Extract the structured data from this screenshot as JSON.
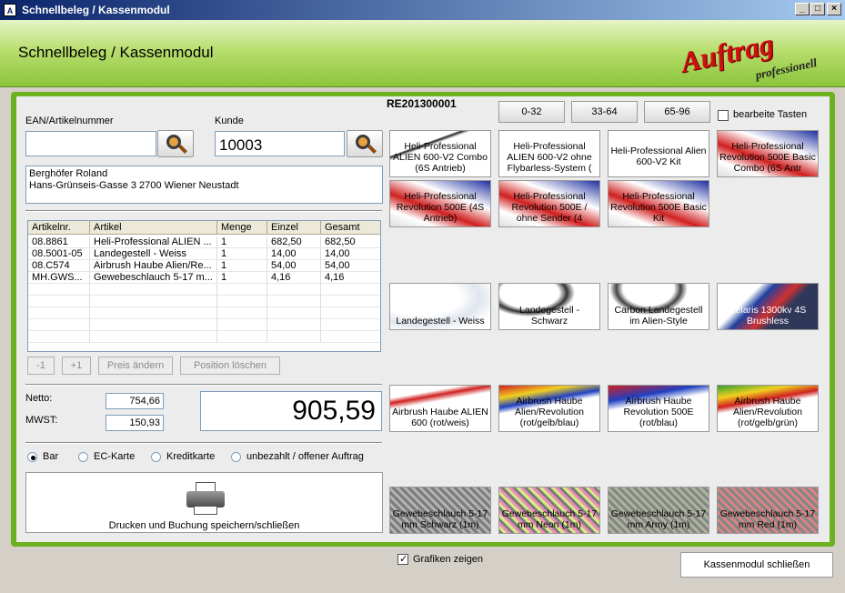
{
  "window": {
    "title": "Schnellbeleg / Kassenmodul",
    "icon": "app-icon"
  },
  "header": {
    "title": "Schnellbeleg / Kassenmodul",
    "logo_main": "Auftrag",
    "logo_sub": "professionell"
  },
  "receipt_no": "RE201300001",
  "ean": {
    "label": "EAN/Artikelnummer",
    "value": ""
  },
  "kunde": {
    "label": "Kunde",
    "value": "10003"
  },
  "address": {
    "line1": "Berghöfer Roland",
    "line2": "Hans-Grünseis-Gasse 3 2700 Wiener Neustadt"
  },
  "table": {
    "headers": [
      "Artikelnr.",
      "Artikel",
      "Menge",
      "Einzel",
      "Gesamt"
    ],
    "rows": [
      [
        "08.8861",
        "Heli-Professional ALIEN ...",
        "1",
        "682,50",
        "682,50"
      ],
      [
        "08.5001-05",
        "Landegestell - Weiss",
        "1",
        "14,00",
        "14,00"
      ],
      [
        "08.C574",
        "Airbrush Haube Alien/Re...",
        "1",
        "54,00",
        "54,00"
      ],
      [
        "MH.GWS...",
        "Gewebeschlauch 5-17 m...",
        "1",
        "4,16",
        "4,16"
      ]
    ]
  },
  "table_buttons": {
    "minus": "-1",
    "plus": "+1",
    "price": "Preis ändern",
    "delete": "Position löschen"
  },
  "sums": {
    "netto_label": "Netto:",
    "netto": "754,66",
    "mwst_label": "MWST:",
    "mwst": "150,93",
    "total": "905,59"
  },
  "payment": {
    "options": [
      "Bar",
      "EC-Karte",
      "Kreditkarte",
      "unbezahlt / offener Auftrag"
    ],
    "selected": "Bar"
  },
  "print_button": "Drucken und Buchung speichern/schließen",
  "categories": [
    "0-32",
    "33-64",
    "65-96"
  ],
  "edit_keys": "bearbeite Tasten",
  "tiles": [
    "Heli-Professional ALIEN 600-V2 Combo (6S Antrieb)",
    "Heli-Professional ALIEN 600-V2 ohne Flybarless-System (",
    "Heli-Professional Alien 600-V2 Kit",
    "Heli-Professional Revolution 500E Basic Combo (6S Antr",
    "Heli-Professional Revolution 500E (4S Antrieb)",
    "Heli-Professional Revolution 500E / ohne Sender (4",
    "Heli-Professional Revolution 500E Basic Kit",
    "Landegestell - Weiss",
    "Landegestell - Schwarz",
    "Carbon Landegestell im Alien-Style",
    "Xelaris 1300kv 4S Brushless",
    "Airbrush Haube ALIEN 600 (rot/weis)",
    "Airbrush Haube Alien/Revolution (rot/gelb/blau)",
    "Airbrush Haube Revolution 500E (rot/blau)",
    "Airbrush Haube Alien/Revolution (rot/gelb/grün)",
    "Gewebeschlauch 5-17 mm Schwarz (1m)",
    "Gewebeschlauch 5-17 mm Neon (1m)",
    "Gewebeschlauch 5-17 mm Army (1m)",
    "Gewebeschlauch 5-17 mm Red (1m)"
  ],
  "graphics_toggle": "Grafiken zeigen",
  "close_button": "Kassenmodul schließen",
  "colors": {
    "accent_green": "#6db020",
    "title_blue": "#0a246a",
    "logo_red": "#d01010"
  }
}
